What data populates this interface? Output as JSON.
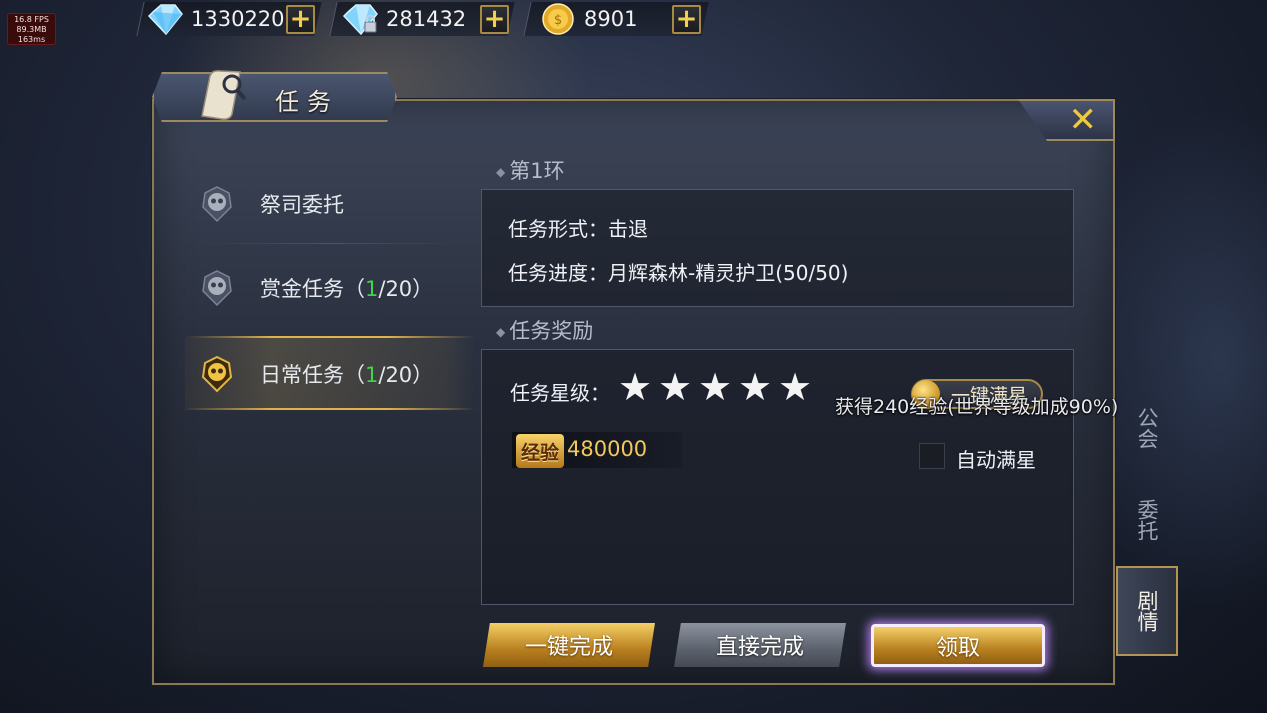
{
  "debug": {
    "fps": "16.8 FPS",
    "memory": "89.3MB",
    "latency": "163ms"
  },
  "currency": {
    "diamond": "1330220",
    "bound_diamond": "281432",
    "gold": "8901"
  },
  "panel": {
    "title": "任务",
    "close_label": "✕"
  },
  "menu": [
    {
      "label": "祭司委托",
      "progress_done": "",
      "progress_total": ""
    },
    {
      "label": "赏金任务（",
      "progress_done": "1",
      "progress_total": "/20）"
    },
    {
      "label": "日常任务（",
      "progress_done": "1",
      "progress_total": "/20）"
    }
  ],
  "ring": {
    "title": "第1环",
    "form": "任务形式：击退",
    "progress": "任务进度：月辉森林-精灵护卫(50/50)"
  },
  "reward": {
    "title": "任务奖励",
    "star_label": "任务星级：",
    "stars": 5,
    "full_star_button": "一键满星",
    "tooltip": "获得240经验(世界等级加成90%)",
    "exp_badge": "经验",
    "exp_value": "480000",
    "auto_full_star": "自动满星"
  },
  "side_tabs": [
    "公会",
    "委托",
    "剧情"
  ],
  "buttons": {
    "one_click": "一键完成",
    "direct": "直接完成",
    "claim": "领取"
  },
  "colors": {
    "accent_gold": "#f4cf4a",
    "progress_green": "#3fd44a",
    "claim_glow": "#be8cff"
  }
}
